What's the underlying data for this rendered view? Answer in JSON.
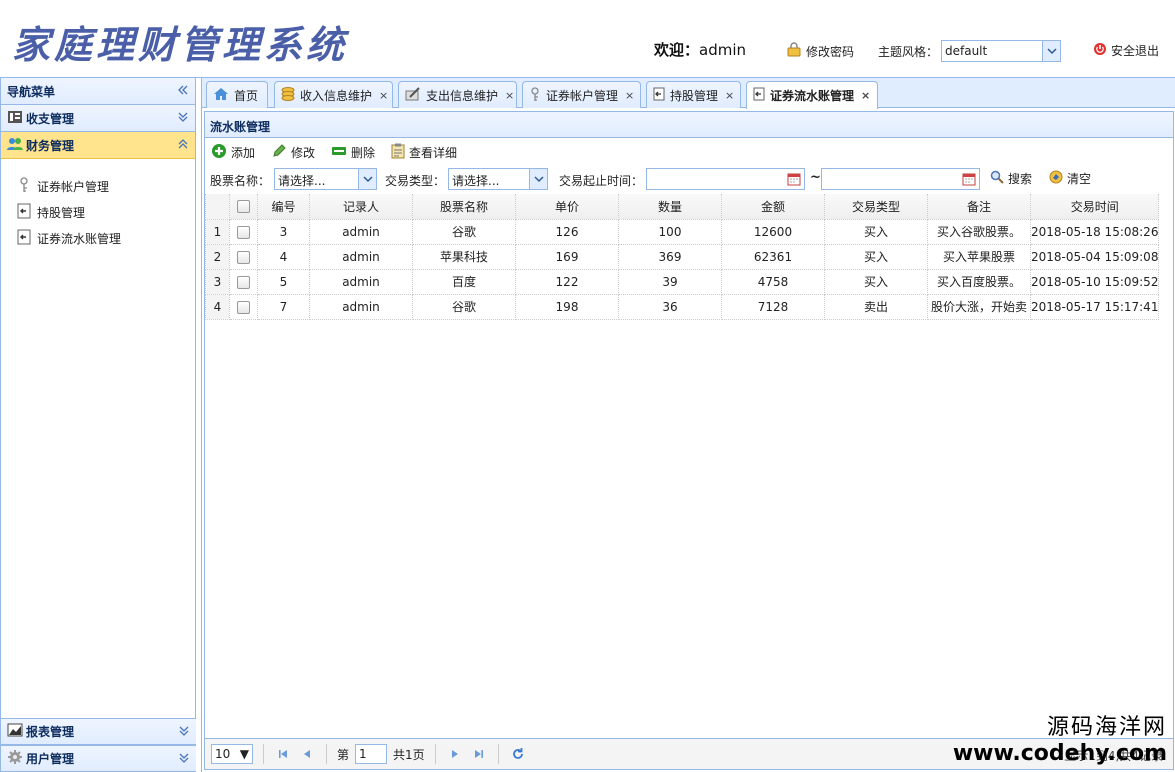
{
  "header": {
    "title": "家庭理财管理系统",
    "welcome_prefix": "欢迎：",
    "username": "admin",
    "change_password": "修改密码",
    "theme_label": "主题风格：",
    "theme_value": "default",
    "logout": "安全退出"
  },
  "sidebar": {
    "title": "导航菜单",
    "panels": [
      {
        "label": "收支管理"
      },
      {
        "label": "财务管理"
      }
    ],
    "items": [
      {
        "label": "证券帐户管理"
      },
      {
        "label": "持股管理"
      },
      {
        "label": "证券流水账管理"
      }
    ],
    "bottom_panels": [
      {
        "label": "报表管理"
      },
      {
        "label": "用户管理"
      }
    ]
  },
  "tabs": [
    {
      "label": "首页"
    },
    {
      "label": "收入信息维护"
    },
    {
      "label": "支出信息维护"
    },
    {
      "label": "证券帐户管理"
    },
    {
      "label": "持股管理"
    },
    {
      "label": "证券流水账管理"
    }
  ],
  "content": {
    "title": "流水账管理",
    "toolbar": {
      "add": "添加",
      "edit": "修改",
      "delete": "删除",
      "detail": "查看详细"
    },
    "filters": {
      "stock_name_label": "股票名称：",
      "stock_name_value": "请选择...",
      "trade_type_label": "交易类型：",
      "trade_type_value": "请选择...",
      "time_label": "交易起止时间：",
      "tilde": "~",
      "search": "搜索",
      "clear": "清空"
    },
    "columns": [
      "编号",
      "记录人",
      "股票名称",
      "单价",
      "数量",
      "金额",
      "交易类型",
      "备注",
      "交易时间"
    ],
    "rows": [
      {
        "rn": "1",
        "id": "3",
        "recorder": "admin",
        "stock": "谷歌",
        "price": "126",
        "qty": "100",
        "amount": "12600",
        "type": "买入",
        "note": "买入谷歌股票。",
        "time": "2018-05-18 15:08:26"
      },
      {
        "rn": "2",
        "id": "4",
        "recorder": "admin",
        "stock": "苹果科技",
        "price": "169",
        "qty": "369",
        "amount": "62361",
        "type": "买入",
        "note": "买入苹果股票",
        "time": "2018-05-04 15:09:08"
      },
      {
        "rn": "3",
        "id": "5",
        "recorder": "admin",
        "stock": "百度",
        "price": "122",
        "qty": "39",
        "amount": "4758",
        "type": "买入",
        "note": "买入百度股票。",
        "time": "2018-05-10 15:09:52"
      },
      {
        "rn": "4",
        "id": "7",
        "recorder": "admin",
        "stock": "谷歌",
        "price": "198",
        "qty": "36",
        "amount": "7128",
        "type": "卖出",
        "note": "股价大涨，开始卖",
        "time": "2018-05-17 15:17:41"
      }
    ],
    "pager": {
      "page_size": "10",
      "page_prefix": "第",
      "page_value": "1",
      "page_total": "共1页",
      "info": "显示1到4,共4记录"
    }
  },
  "watermark": {
    "cn": "源码海洋网",
    "en": "www.codehy.com"
  }
}
